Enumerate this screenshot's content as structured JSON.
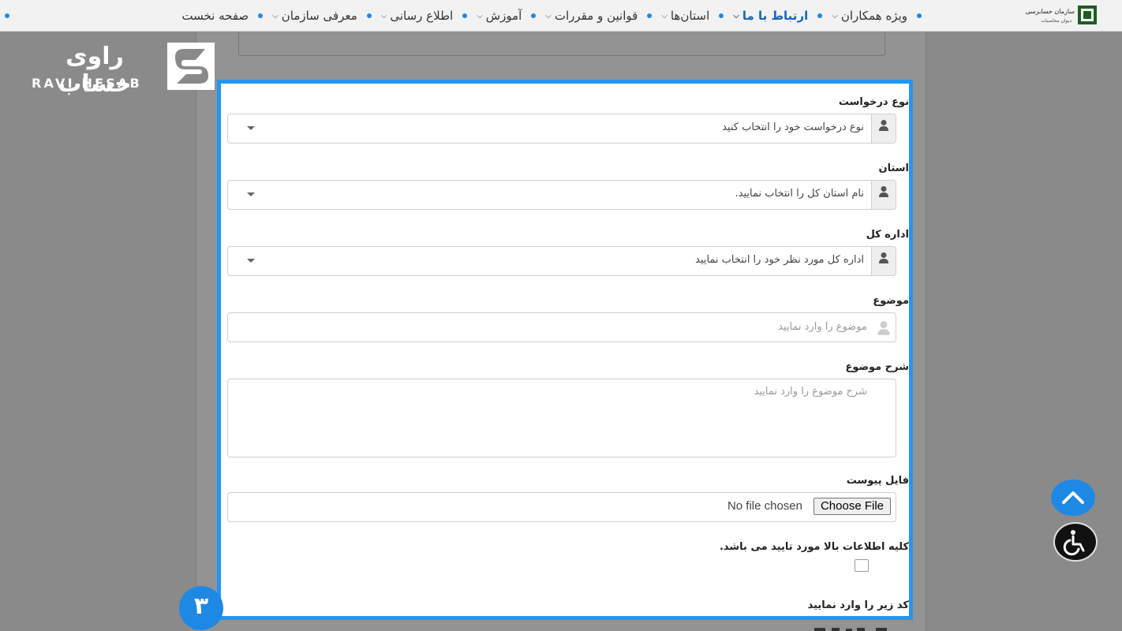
{
  "nav": {
    "items": [
      {
        "label": "صفحه نخست",
        "has_dropdown": false,
        "active": false
      },
      {
        "label": "معرفی سازمان",
        "has_dropdown": true,
        "active": false
      },
      {
        "label": "اطلاع رسانی",
        "has_dropdown": true,
        "active": false
      },
      {
        "label": "آموزش",
        "has_dropdown": true,
        "active": false
      },
      {
        "label": "قوانین و مقررات",
        "has_dropdown": true,
        "active": false
      },
      {
        "label": "استان‌ها",
        "has_dropdown": true,
        "active": false
      },
      {
        "label": "ارتباط با ما",
        "has_dropdown": true,
        "active": true
      },
      {
        "label": "ویژه همکاران",
        "has_dropdown": true,
        "active": false
      }
    ],
    "accent_color": "#1e88e5",
    "logo_icon": "org-emblem-icon"
  },
  "watermark": {
    "brand_fa": "راوی حساب",
    "brand_en": "RAVI HESAB"
  },
  "form": {
    "request_type": {
      "label": "نوع درخواست",
      "value": "نوع درخواست خود را انتخاب کنید"
    },
    "province": {
      "label": "استان",
      "value": "نام استان کل را انتخاب نمایید."
    },
    "department": {
      "label": "اداره کل",
      "value": "اداره کل مورد نظر خود را انتخاب نمایید"
    },
    "subject": {
      "label": "موضوع",
      "placeholder": "موضوع را وارد نمایید"
    },
    "description": {
      "label": "شرح موضوع",
      "placeholder": "شرح موضوع را وارد نمایید"
    },
    "attachment": {
      "label": "فایل پیوست",
      "button_label": "Choose File",
      "status": "No file chosen"
    },
    "confirm": {
      "label": "کلیه اطلاعات بالا مورد تایید می باشد.",
      "checked": false
    },
    "captcha": {
      "label": "کد زیر را وارد نمایید"
    },
    "highlight_color": "#2196f3"
  },
  "step_badge": "۳",
  "floating": {
    "scroll_top_icon": "chevron-up-icon",
    "accessibility_icon": "wheelchair-icon"
  }
}
